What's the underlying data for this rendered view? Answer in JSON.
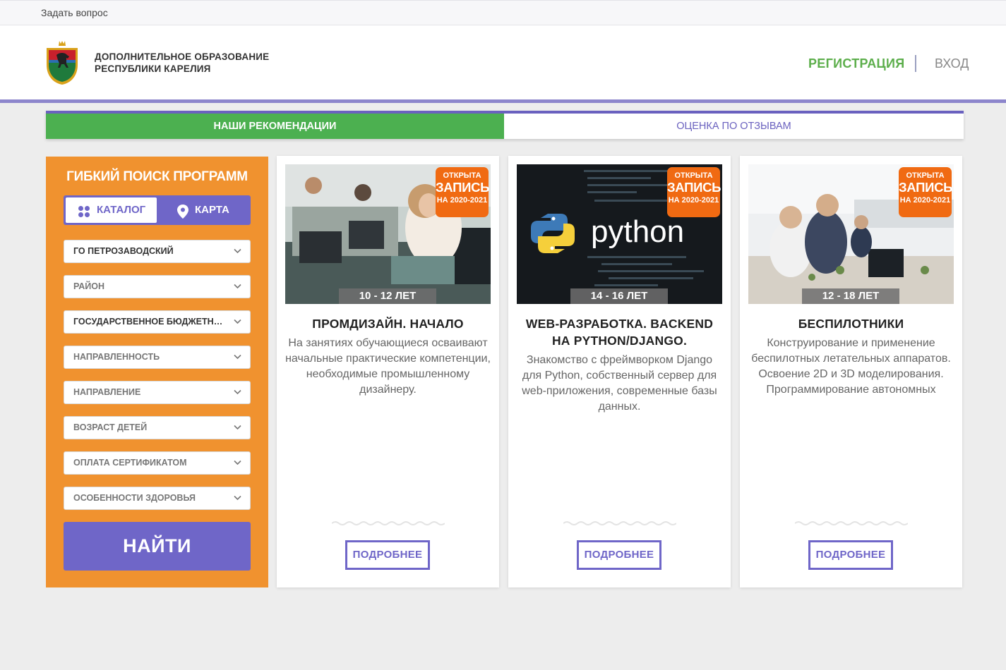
{
  "topbar": {
    "ask_link": "Задать вопрос"
  },
  "header": {
    "brand_line1": "ДОПОЛНИТЕЛЬНОЕ ОБРАЗОВАНИЕ",
    "brand_line2": "РЕСПУБЛИКИ КАРЕЛИЯ",
    "register_label": "РЕГИСТРАЦИЯ",
    "login_label": "ВХОД"
  },
  "tabs": [
    {
      "label": "НАШИ РЕКОМЕНДАЦИИ",
      "active": true
    },
    {
      "label": "ОЦЕНКА ПО ОТЗЫВАМ",
      "active": false
    }
  ],
  "filter": {
    "title": "ГИБКИЙ ПОИСК ПРОГРАММ",
    "catalog_label": "КАТАЛОГ",
    "map_label": "КАРТА",
    "selects": [
      {
        "value": "ГО ПЕТРОЗАВОДСКИЙ",
        "selected": true
      },
      {
        "value": "РАЙОН",
        "selected": false
      },
      {
        "value": "ГОСУДАРСТВЕННОЕ БЮДЖЕТНО...",
        "selected": true
      },
      {
        "value": "НАПРАВЛЕННОСТЬ",
        "selected": false
      },
      {
        "value": "НАПРАВЛЕНИЕ",
        "selected": false
      },
      {
        "value": "ВОЗРАСТ ДЕТЕЙ",
        "selected": false
      },
      {
        "value": "ОПЛАТА СЕРТИФИКАТОМ",
        "selected": false
      },
      {
        "value": "ОСОБЕННОСТИ ЗДОРОВЬЯ",
        "selected": false
      }
    ],
    "find_label": "НАЙТИ"
  },
  "cards": [
    {
      "badge_line1": "ОТКРЫТА",
      "badge_line2": "ЗАПИСЬ",
      "badge_line3": "НА 2020-2021",
      "age": "10 - 12 ЛЕТ",
      "title": "ПРОМДИЗАЙН. НАЧАЛО",
      "description": "На занятиях обучающиеся осваивают начальные практические компетенции, необходимые промышленному дизайнеру.",
      "more_label": "ПОДРОБНЕЕ"
    },
    {
      "badge_line1": "ОТКРЫТА",
      "badge_line2": "ЗАПИСЬ",
      "badge_line3": "НА 2020-2021",
      "age": "14 - 16 ЛЕТ",
      "title": "WEB-РАЗРАБОТКА. BACKEND НА PYTHON/DJANGO.",
      "image_text": "python",
      "description": "Знакомство с фреймворком Django для Python, собственный сервер для web-приложения, современные базы данных.",
      "more_label": "ПОДРОБНЕЕ"
    },
    {
      "badge_line1": "ОТКРЫТА",
      "badge_line2": "ЗАПИСЬ",
      "badge_line3": "НА 2020-2021",
      "age": "12 - 18 ЛЕТ",
      "title": "БЕСПИЛОТНИКИ",
      "description": "Конструирование и применение беспилотных летательных аппаратов. Освоение 2D и 3D моделирования. Программирование автономных",
      "more_label": "ПОДРОБНЕЕ"
    }
  ],
  "colors": {
    "accent_purple": "#6f66c8",
    "green": "#4cb050",
    "orange": "#f0922f",
    "badge_orange": "#f06a12"
  }
}
